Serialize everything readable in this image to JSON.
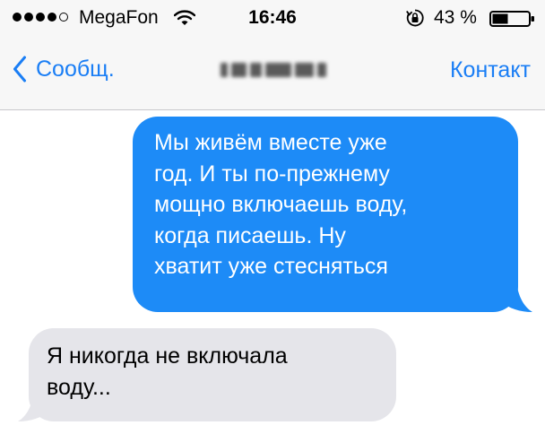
{
  "status_bar": {
    "carrier": "MegaFon",
    "time": "16:46",
    "battery_percent": "43 %",
    "signal_bars_filled": 4,
    "signal_bars_total": 5
  },
  "nav_bar": {
    "back_label": "Сообщ.",
    "contact_action_label": "Контакт"
  },
  "messages": [
    {
      "direction": "outgoing",
      "lines": [
        "Мы живём вместе уже",
        "год. И ты по-прежнему",
        "мощно включаешь воду,",
        "когда писаешь. Ну",
        "хватит уже стесняться"
      ]
    },
    {
      "direction": "incoming",
      "lines": [
        "Я никогда не включала",
        "воду..."
      ]
    }
  ],
  "colors": {
    "accent": "#1a7ef5",
    "outgoing_bubble": "#1d8bf7",
    "incoming_bubble": "#e5e5ea",
    "bar_background": "#f7f7f7"
  }
}
